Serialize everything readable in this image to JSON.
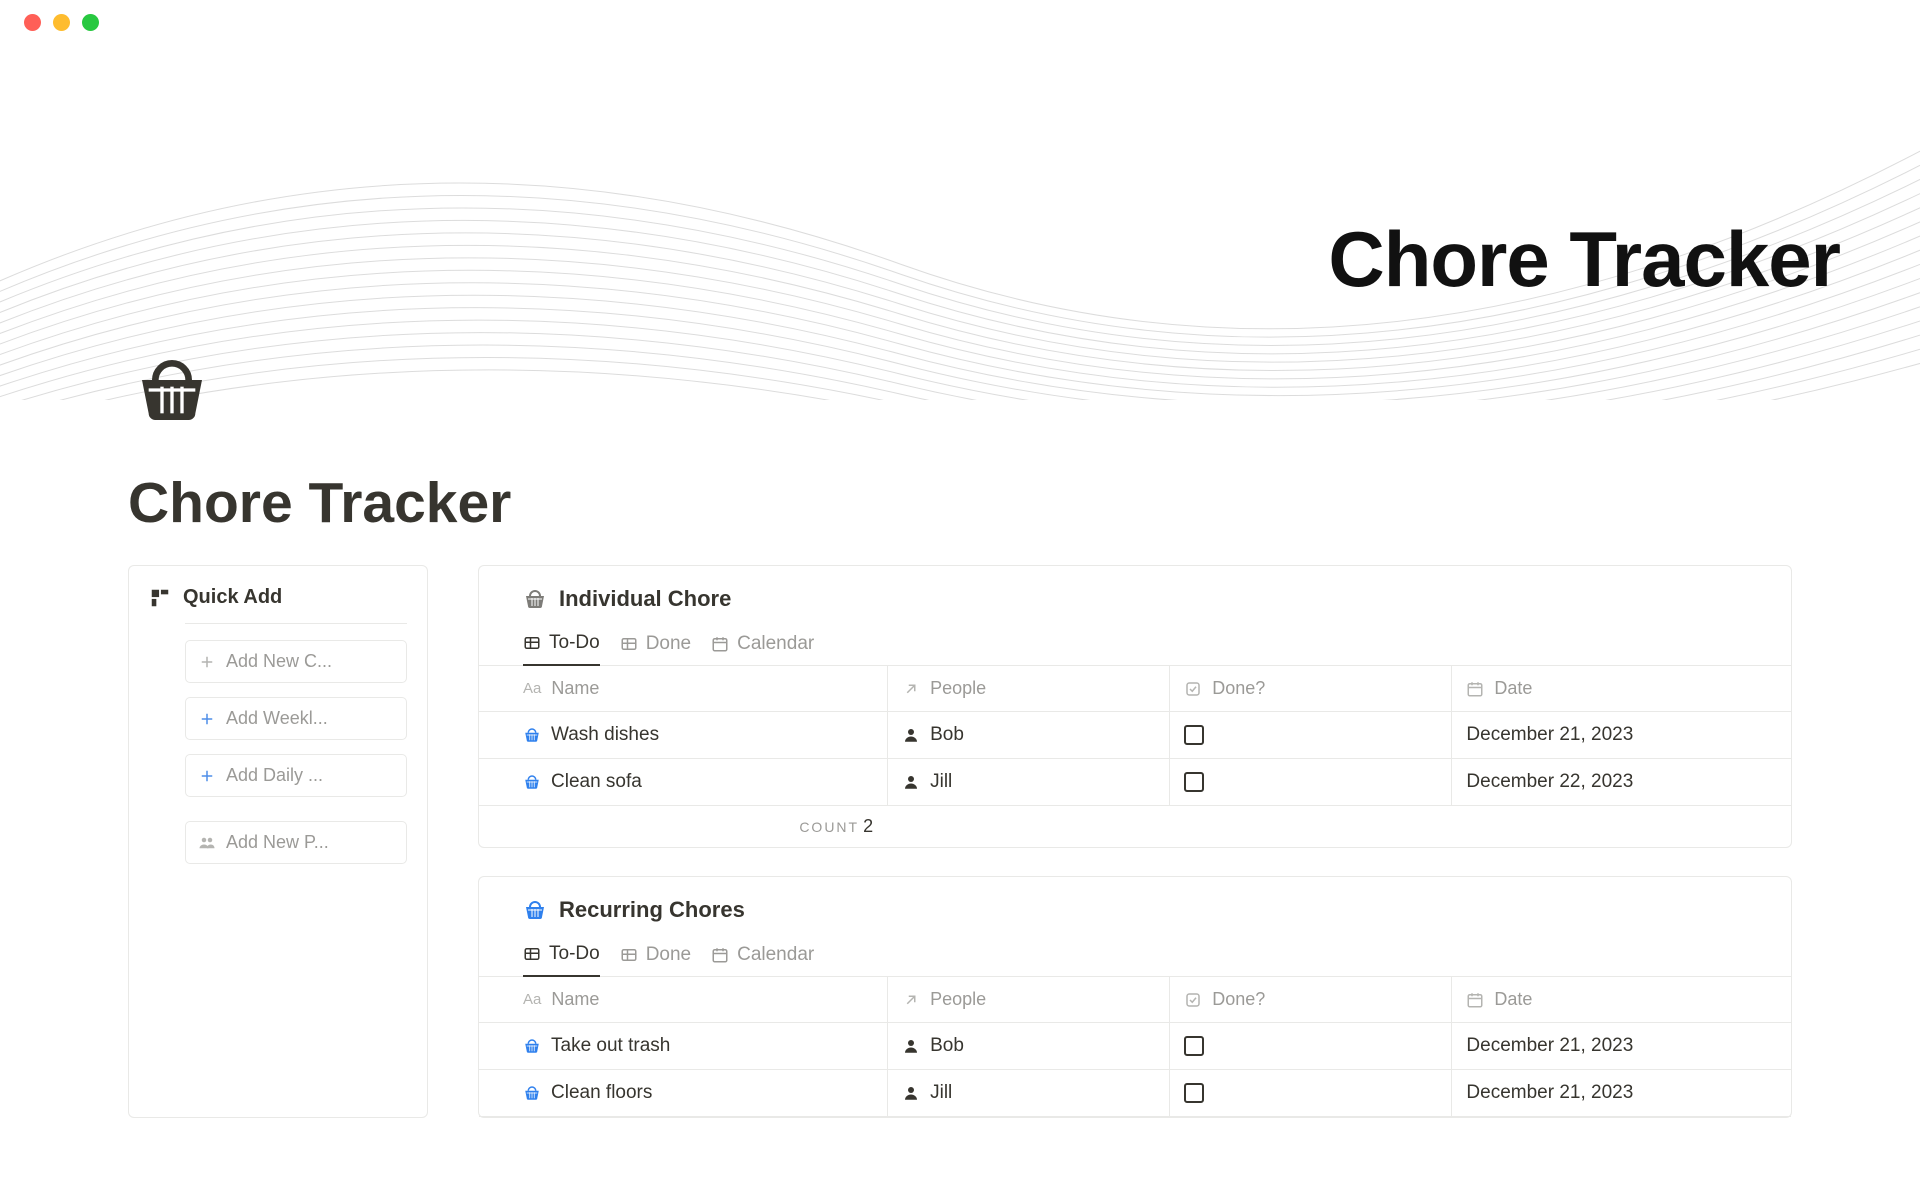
{
  "cover": {
    "title": "Chore Tracker"
  },
  "page": {
    "title": "Chore Tracker"
  },
  "sidebar": {
    "title": "Quick Add",
    "buttons": [
      {
        "label": "Add New C..."
      },
      {
        "label": "Add Weekl..."
      },
      {
        "label": "Add Daily ..."
      },
      {
        "label": "Add New P..."
      }
    ]
  },
  "individual": {
    "title": "Individual Chore",
    "tabs": [
      "To-Do",
      "Done",
      "Calendar"
    ],
    "columns": {
      "name": "Name",
      "people": "People",
      "done": "Done?",
      "date": "Date"
    },
    "rows": [
      {
        "name": "Wash dishes",
        "people": "Bob",
        "done": false,
        "date": "December 21, 2023"
      },
      {
        "name": "Clean sofa",
        "people": "Jill",
        "done": false,
        "date": "December 22, 2023"
      }
    ],
    "count_label": "COUNT",
    "count": "2"
  },
  "recurring": {
    "title": "Recurring Chores",
    "tabs": [
      "To-Do",
      "Done",
      "Calendar"
    ],
    "columns": {
      "name": "Name",
      "people": "People",
      "done": "Done?",
      "date": "Date"
    },
    "rows": [
      {
        "name": "Take out trash",
        "people": "Bob",
        "done": false,
        "date": "December 21, 2023"
      },
      {
        "name": "Clean floors",
        "people": "Jill",
        "done": false,
        "date": "December 21, 2023"
      }
    ]
  }
}
